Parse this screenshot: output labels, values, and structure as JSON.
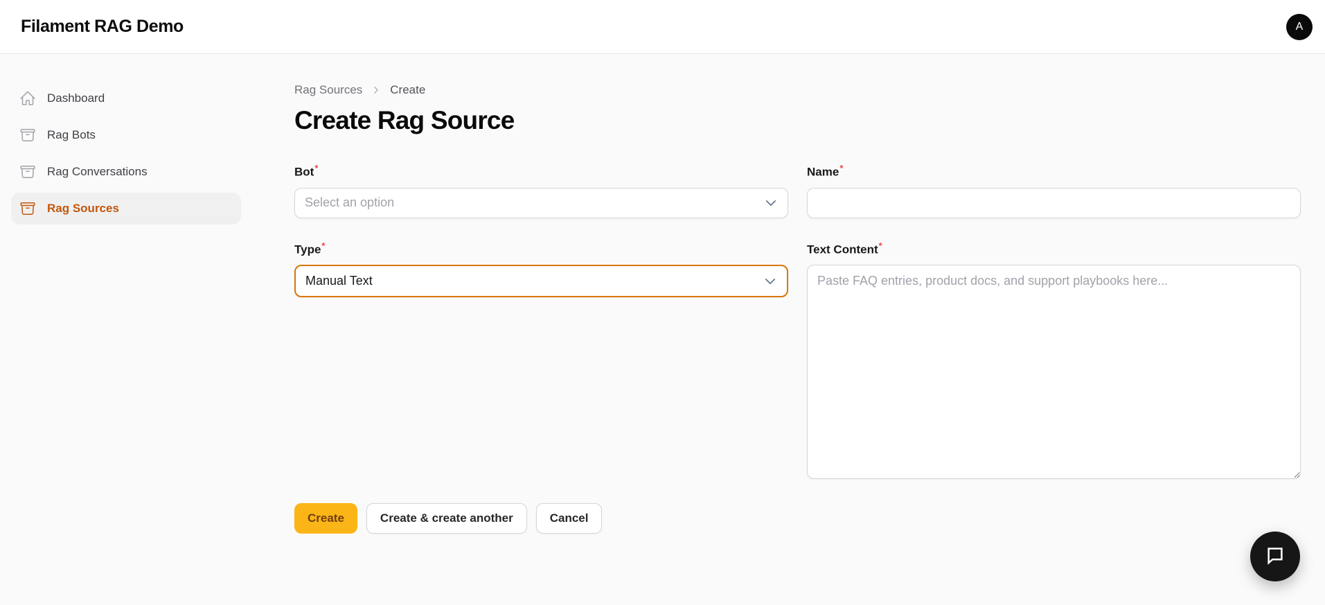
{
  "topbar": {
    "brand": "Filament RAG Demo",
    "avatar_initial": "A"
  },
  "sidebar": {
    "items": [
      {
        "label": "Dashboard",
        "icon": "home-icon",
        "active": false
      },
      {
        "label": "Rag Bots",
        "icon": "archive-box-icon",
        "active": false
      },
      {
        "label": "Rag Conversations",
        "icon": "archive-box-icon",
        "active": false
      },
      {
        "label": "Rag Sources",
        "icon": "archive-box-icon",
        "active": true
      }
    ]
  },
  "breadcrumb": {
    "parent": "Rag Sources",
    "current": "Create"
  },
  "page": {
    "title": "Create Rag Source"
  },
  "form": {
    "required_marker": "*",
    "bot": {
      "label": "Bot",
      "placeholder": "Select an option"
    },
    "name": {
      "label": "Name",
      "value": ""
    },
    "type": {
      "label": "Type",
      "value": "Manual Text"
    },
    "text_content": {
      "label": "Text Content",
      "placeholder": "Paste FAQ entries, product docs, and support playbooks here..."
    }
  },
  "actions": {
    "create": "Create",
    "create_another": "Create & create another",
    "cancel": "Cancel"
  },
  "colors": {
    "primary_button_bg": "#fbb516",
    "primary_button_text": "#713f12",
    "active_nav": "#c2570c",
    "focus_border": "#d97706",
    "required_marker": "#ef4444",
    "page_bg": "#fafafa",
    "fab_bg": "#161616"
  }
}
